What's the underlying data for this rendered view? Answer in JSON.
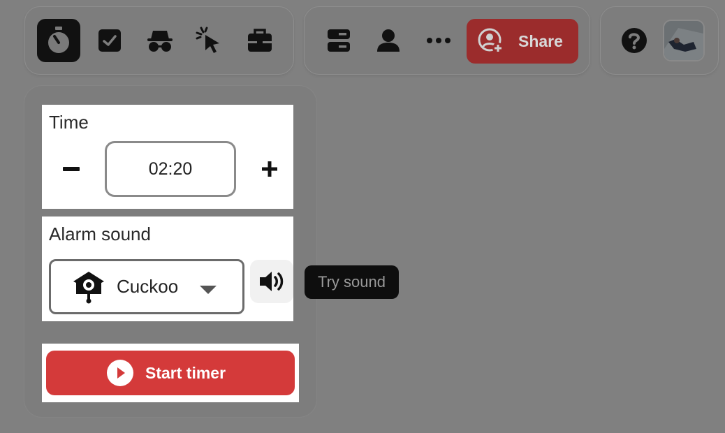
{
  "toolbar": {
    "tools": [
      {
        "name": "timer",
        "icon": "stopwatch-icon",
        "active": true
      },
      {
        "name": "voting",
        "icon": "checkbox-icon",
        "active": false
      },
      {
        "name": "private-mode",
        "icon": "incognito-icon",
        "active": false
      },
      {
        "name": "follow",
        "icon": "cursor-click-icon",
        "active": false
      },
      {
        "name": "toolbox",
        "icon": "toolbox-icon",
        "active": false
      }
    ],
    "share_label": "Share",
    "more_icon": "ellipsis-icon"
  },
  "timer": {
    "time_title": "Time",
    "time_value": "02:20",
    "decrease_icon": "minus-icon",
    "increase_icon": "plus-icon",
    "alarm_title": "Alarm sound",
    "alarm_value": "Cuckoo",
    "try_sound_tooltip": "Try sound",
    "start_label": "Start timer"
  },
  "colors": {
    "overlay": "#808080",
    "start": "#d43a3a",
    "share": "#9b2c2c",
    "tooltip": "#0e0e0e"
  }
}
